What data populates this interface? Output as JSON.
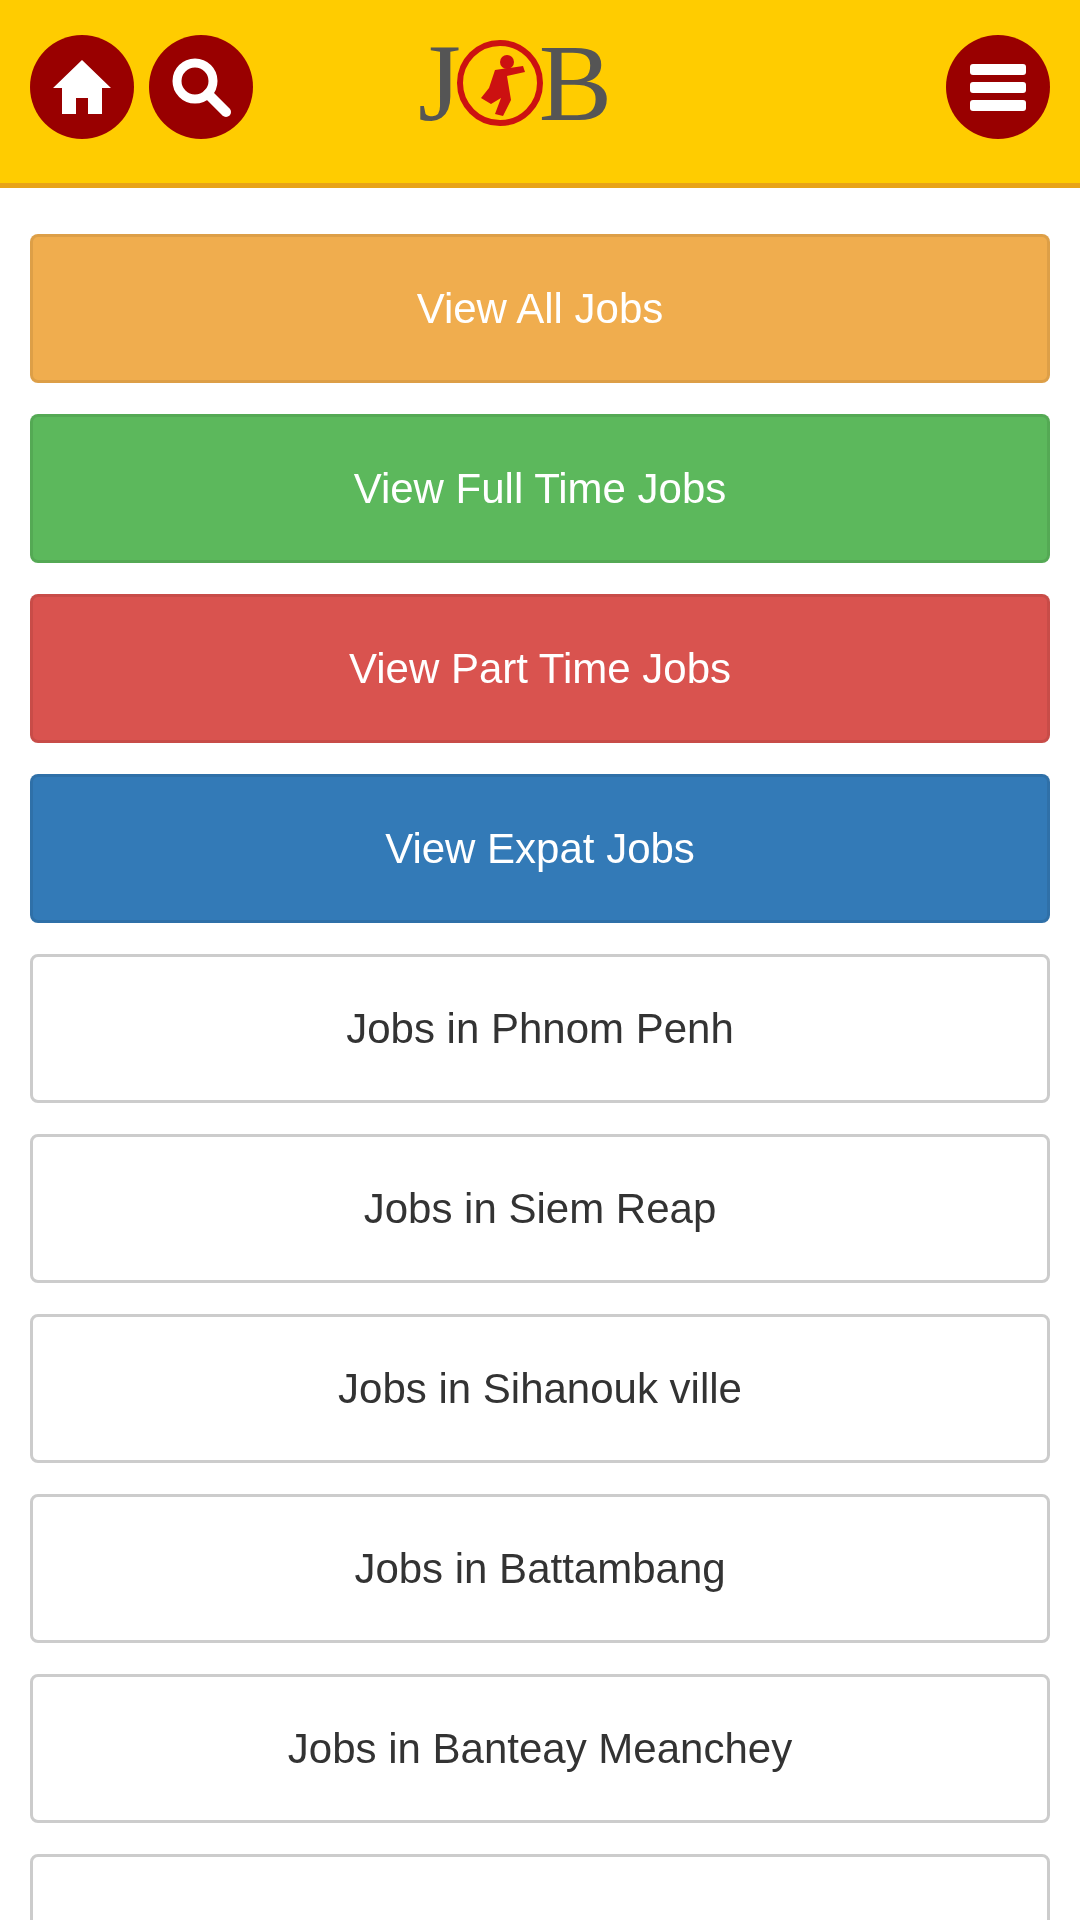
{
  "header": {
    "logo": {
      "left": "J",
      "right": "B"
    }
  },
  "buttons": [
    {
      "label": "View All Jobs",
      "color": "#f0ad4e"
    },
    {
      "label": "View Full Time Jobs",
      "color": "#5cb85c"
    },
    {
      "label": "View Part Time Jobs",
      "color": "#d9534f"
    },
    {
      "label": "View Expat Jobs",
      "color": "#337ab7"
    },
    {
      "label": "Jobs in Phnom Penh",
      "color": "#ffffff"
    },
    {
      "label": "Jobs in Siem Reap",
      "color": "#ffffff"
    },
    {
      "label": "Jobs in Sihanouk ville",
      "color": "#ffffff"
    },
    {
      "label": "Jobs in Battambang",
      "color": "#ffffff"
    },
    {
      "label": "Jobs in Banteay Meanchey",
      "color": "#ffffff"
    },
    {
      "color": "#ffffff"
    }
  ]
}
